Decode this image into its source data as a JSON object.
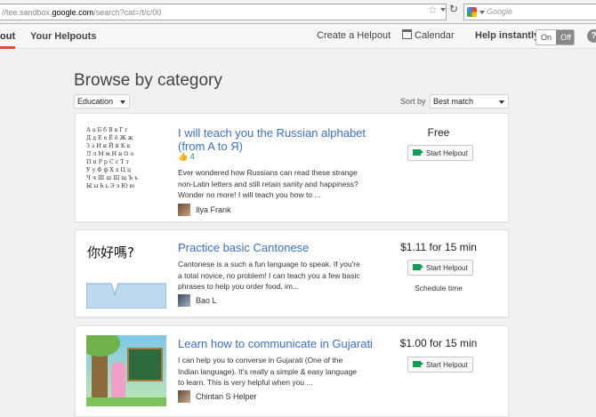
{
  "browser": {
    "url_prefix": "//tee.sandbox.",
    "url_domain": "google.com",
    "url_suffix": "/search?cat=/t/c/00",
    "search_placeholder": "Google"
  },
  "header": {
    "nav_partial": "out",
    "your_helpouts": "Your Helpouts",
    "create": "Create a Helpout",
    "calendar": "Calendar",
    "help_instantly": "Help instantly",
    "toggle_on": "On",
    "toggle_off": "Off",
    "help_glyph": "?"
  },
  "main": {
    "heading": "Browse by category",
    "category": "Education",
    "sort_label": "Sort by",
    "sort_value": "Best match"
  },
  "listings": [
    {
      "title": "I will teach you the Russian alphabet (from A to Я)",
      "likes": "4",
      "description": "Ever wondered how Russians can read these strange non-Latin letters and still retain sanity and happiness? Wonder no more! I will teach you how to ...",
      "author": "Ilya Frank",
      "price": "Free",
      "button": "Start Helpout",
      "thumb_rows": [
        "А а Б б В в Г г",
        "Д д Е е Ё ё Ж ж",
        "З з И и Й й К к",
        "Л л М м Н н О о",
        "П п Р р С с Т т",
        "У у Ф ф Х х Ц ц",
        "Ч ч Ш ш Щ щ Ъ ъ",
        "Ы ы Ь ь Э э Ю ю"
      ]
    },
    {
      "title": "Practice basic Cantonese",
      "description": "Cantonese is a such a fun language to speak. If you're a total novice, no problem! I can teach you a few basic phrases to help you order food, im...",
      "author": "Bao L",
      "price": "$1.11 for 15 min",
      "button": "Start Helpout",
      "schedule": "Schedule time",
      "thumb_text": "你好嗎?"
    },
    {
      "title": "Learn how to communicate in Gujarati",
      "description": "I can help you to converse in Gujarati (One of the Indian language). It's really a simple & easy language to learn. This is very helpful when you ...",
      "author": "Chintan S Helper",
      "price": "$1.00 for 15 min",
      "button": "Start Helpout"
    }
  ]
}
